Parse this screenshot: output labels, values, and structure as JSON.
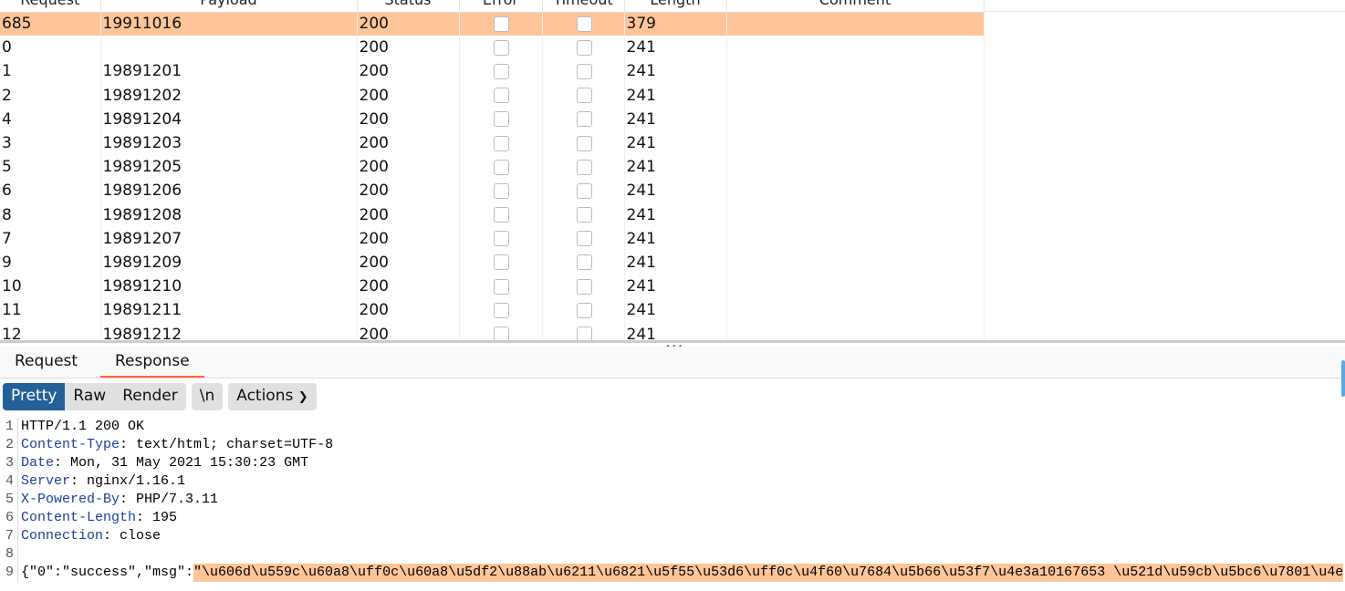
{
  "table": {
    "headers": [
      "Request",
      "Payload",
      "Status",
      "Error",
      "Timeout",
      "Length",
      "Comment"
    ],
    "rows": [
      {
        "request": "685",
        "payload": "19911016",
        "status": "200",
        "length": "379",
        "selected": true
      },
      {
        "request": "0",
        "payload": "",
        "status": "200",
        "length": "241"
      },
      {
        "request": "1",
        "payload": "19891201",
        "status": "200",
        "length": "241"
      },
      {
        "request": "2",
        "payload": "19891202",
        "status": "200",
        "length": "241"
      },
      {
        "request": "4",
        "payload": "19891204",
        "status": "200",
        "length": "241"
      },
      {
        "request": "3",
        "payload": "19891203",
        "status": "200",
        "length": "241"
      },
      {
        "request": "5",
        "payload": "19891205",
        "status": "200",
        "length": "241"
      },
      {
        "request": "6",
        "payload": "19891206",
        "status": "200",
        "length": "241"
      },
      {
        "request": "8",
        "payload": "19891208",
        "status": "200",
        "length": "241"
      },
      {
        "request": "7",
        "payload": "19891207",
        "status": "200",
        "length": "241"
      },
      {
        "request": "9",
        "payload": "19891209",
        "status": "200",
        "length": "241"
      },
      {
        "request": "10",
        "payload": "19891210",
        "status": "200",
        "length": "241"
      },
      {
        "request": "11",
        "payload": "19891211",
        "status": "200",
        "length": "241"
      },
      {
        "request": "12",
        "payload": "19891212",
        "status": "200",
        "length": "241"
      }
    ]
  },
  "tabs": [
    "Request",
    "Response"
  ],
  "active_tab": "Response",
  "toolbar": {
    "pretty": "Pretty",
    "raw": "Raw",
    "render": "Render",
    "newline": "\\n",
    "actions": "Actions"
  },
  "response": {
    "lines": [
      {
        "n": "1",
        "key": "",
        "val": "HTTP/1.1 200 OK"
      },
      {
        "n": "2",
        "key": "Content-Type",
        "val": " text/html; charset=UTF-8"
      },
      {
        "n": "3",
        "key": "Date",
        "val": " Mon, 31 May 2021 15:30:23 GMT"
      },
      {
        "n": "4",
        "key": "Server",
        "val": " nginx/1.16.1"
      },
      {
        "n": "5",
        "key": "X-Powered-By",
        "val": " PHP/7.3.11"
      },
      {
        "n": "6",
        "key": "Content-Length",
        "val": " 195"
      },
      {
        "n": "7",
        "key": "Connection",
        "val": " close"
      },
      {
        "n": "8",
        "key": "",
        "val": ""
      }
    ],
    "body_line_num": "9",
    "body_prefix": "{\"0\":\"success\",\"msg\":",
    "body_highlight": "\"\\u606d\\u559c\\u60a8\\uff0c\\u60a8\\u5df2\\u88ab\\u6211\\u6821\\u5f55\\u53d6\\uff0c\\u4f60\\u7684\\u5b66\\u53f7\\u4e3a10167653 \\u521d\\u59cb\\u5bc6\\u7801\\u4e"
  },
  "colors": {
    "selected_row": "#ffc599",
    "accent": "#ff6633",
    "pretty_active": "#236198"
  }
}
